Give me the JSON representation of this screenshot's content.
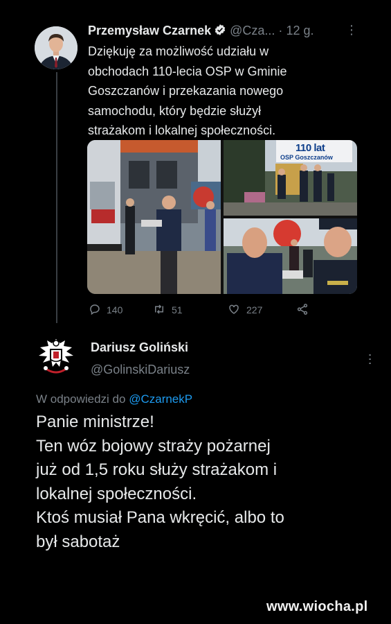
{
  "tweet1": {
    "author_name": "Przemysław Czarnek",
    "handle": "@Cza...",
    "dot": "·",
    "time": "12 g.",
    "text_lines": [
      "Dziękuję za możliwość udziału w",
      "obchodach 110-lecia OSP w Gminie",
      "Goszczanów i przekazania nowego",
      "samochodu, który będzie służył",
      "strażakom i lokalnej społeczności."
    ],
    "photo_banner_title": "110 lat",
    "photo_banner_subtitle": "OSP Goszczanów",
    "reply_count": "140",
    "retweet_count": "51",
    "like_count": "227",
    "icons": [
      "verified-badge-icon",
      "more-icon",
      "reply-icon",
      "retweet-icon",
      "like-icon",
      "share-icon"
    ]
  },
  "tweet2": {
    "author_name": "Dariusz Goliński",
    "handle": "@GolinskiDariusz",
    "reply_prefix": "W odpowiedzi do",
    "reply_mention": "@CzarnekP",
    "text_lines": [
      "Panie ministrze!",
      "Ten wóz bojowy straży pożarnej",
      "już od 1,5 roku służy strażakom i",
      "lokalnej społeczności.",
      "Ktoś musiał Pana wkręcić, albo to",
      "był sabotaż"
    ]
  },
  "watermark": "www.wiocha.pl",
  "colors": {
    "background": "#000000",
    "text": "#e7e9ea",
    "muted": "#7a8188",
    "link": "#1d9bf0",
    "verified": "#e7e9ea"
  }
}
